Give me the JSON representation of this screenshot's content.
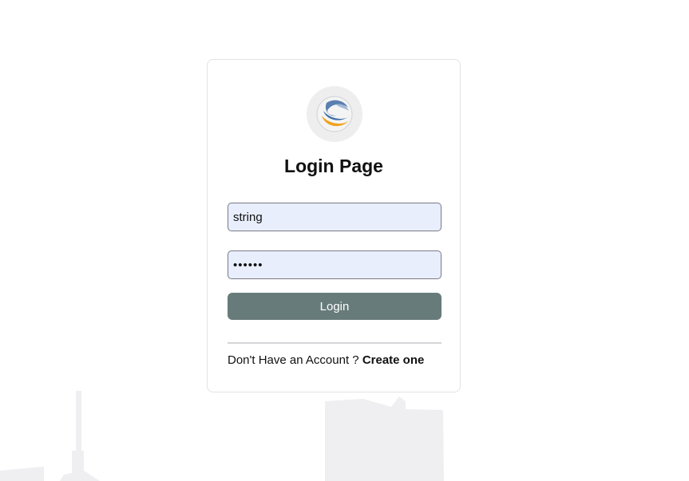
{
  "background": {
    "skyline_color": "#efeef1"
  },
  "login_card": {
    "logo_icon": "globe-logo-icon",
    "title": "Login Page",
    "username_value": "string",
    "password_value": "••••••",
    "login_label": "Login",
    "prompt_text": "Don't Have an Account ?",
    "create_link": "Create one"
  },
  "colors": {
    "input_bg": "#e8eefc",
    "button_bg": "#677b7a",
    "logo_orange": "#f0a21e",
    "logo_blue": "#3f6fa8"
  }
}
